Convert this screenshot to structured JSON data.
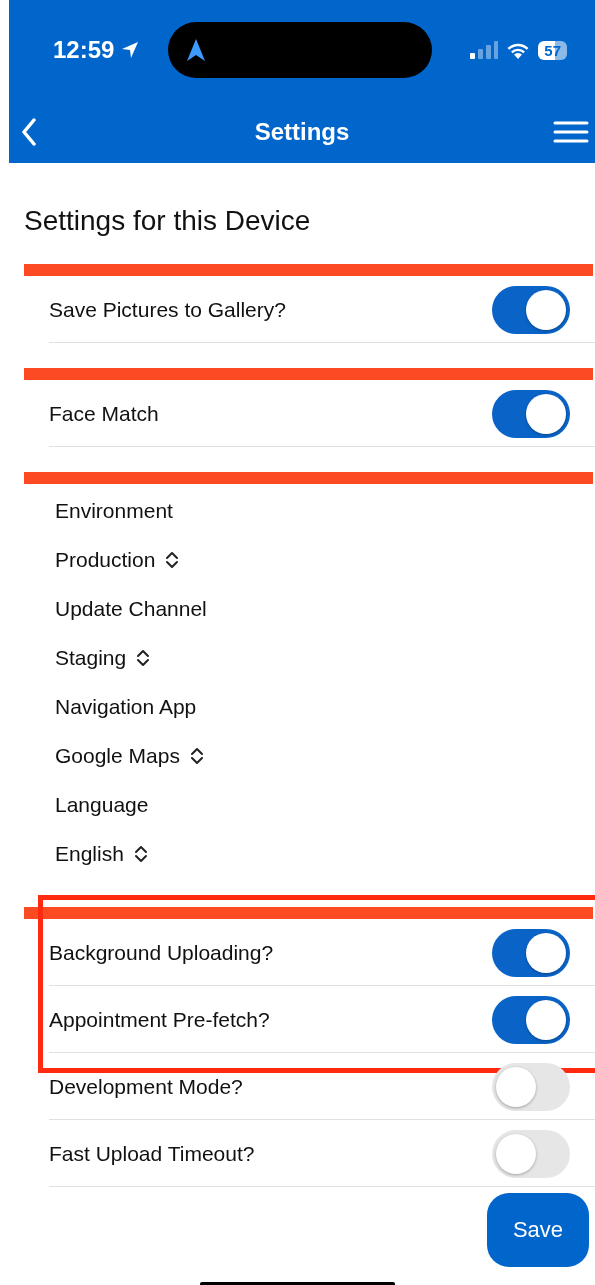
{
  "status_bar": {
    "time": "12:59",
    "battery": "57"
  },
  "nav": {
    "title": "Settings"
  },
  "heading": "Settings for this Device",
  "groups": [
    {
      "kind": "toggles",
      "items": [
        {
          "label": "Save Pictures to Gallery?",
          "on": true,
          "highlighted": false
        }
      ]
    },
    {
      "kind": "toggles",
      "items": [
        {
          "label": "Face Match",
          "on": true,
          "highlighted": false
        }
      ]
    },
    {
      "kind": "pickers",
      "items": [
        {
          "label": "Environment",
          "value": "Production"
        },
        {
          "label": "Update Channel",
          "value": "Staging"
        },
        {
          "label": "Navigation App",
          "value": "Google Maps"
        },
        {
          "label": "Language",
          "value": "English"
        }
      ]
    },
    {
      "kind": "toggles",
      "items": [
        {
          "label": "Background Uploading?",
          "on": true,
          "highlighted": true
        },
        {
          "label": "Appointment Pre-fetch?",
          "on": true,
          "highlighted": true
        },
        {
          "label": "Development Mode?",
          "on": false,
          "highlighted": false
        },
        {
          "label": "Fast Upload Timeout?",
          "on": false,
          "highlighted": false
        }
      ]
    }
  ],
  "save_button": "Save"
}
